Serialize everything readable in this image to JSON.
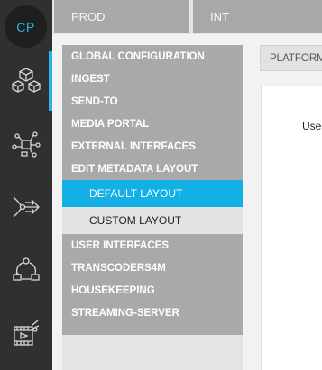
{
  "brand": {
    "logo_text": "CP"
  },
  "rail": {
    "items": [
      {
        "icon": "cube-network-icon",
        "active": true
      },
      {
        "icon": "integration-flow-icon",
        "active": false
      },
      {
        "icon": "send-routing-icon",
        "active": false
      },
      {
        "icon": "cycle-workflow-icon",
        "active": false
      },
      {
        "icon": "media-tools-icon",
        "active": false
      }
    ]
  },
  "environments": [
    {
      "label": "PROD"
    },
    {
      "label": "INT"
    }
  ],
  "menu": {
    "items": [
      {
        "label": "GLOBAL CONFIGURATION"
      },
      {
        "label": "INGEST"
      },
      {
        "label": "SEND-TO"
      },
      {
        "label": "MEDIA PORTAL"
      },
      {
        "label": "EXTERNAL INTERFACES"
      },
      {
        "label": "EDIT METADATA LAYOUT"
      }
    ],
    "subitems": [
      {
        "label": "DEFAULT LAYOUT",
        "selected": true
      },
      {
        "label": "CUSTOM LAYOUT",
        "selected": false
      }
    ],
    "items_after": [
      {
        "label": "USER INTERFACES"
      },
      {
        "label": "TRANSCODERS4M"
      },
      {
        "label": "HOUSEKEEPING"
      },
      {
        "label": "STREAMING-SERVER"
      }
    ]
  },
  "content": {
    "tab_label": "PLATFORM",
    "field_label": "Use"
  },
  "colors": {
    "accent": "#12b0e4",
    "rail_bg": "#303030",
    "menu_bg": "#a9a9a9",
    "env_tab_bg": "#a8a8a8"
  }
}
